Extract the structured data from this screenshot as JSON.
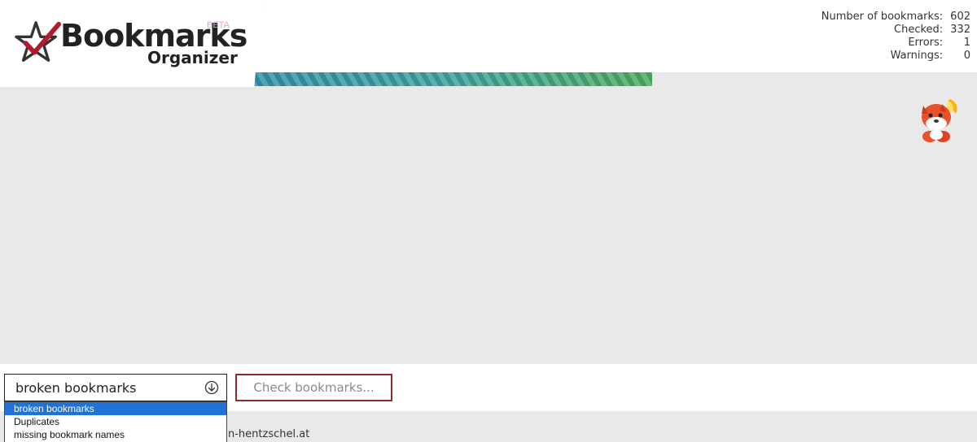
{
  "logo": {
    "title": "Bookmarks",
    "beta": "BETA",
    "subtitle": "Organizer"
  },
  "progress": {
    "fraction": 0.552
  },
  "stats": [
    {
      "label": "Number of bookmarks:",
      "value": "602"
    },
    {
      "label": "Checked:",
      "value": "332"
    },
    {
      "label": "Errors:",
      "value": "1"
    },
    {
      "label": "Warnings:",
      "value": "0"
    }
  ],
  "filter": {
    "selected": "broken bookmarks",
    "options": [
      "broken bookmarks",
      "Duplicates",
      "missing bookmark names"
    ]
  },
  "check_button": {
    "label": "Check bookmarks..."
  },
  "footer": {
    "text": "n-hentzschel.at"
  },
  "colors": {
    "accent": "#1e72d8",
    "button_border": "#8e2a2a",
    "progress_start": "#2f8ea6",
    "progress_end": "#4aa85b"
  },
  "icons": {
    "logo": "star-check-icon",
    "chevron": "circle-arrow-down-icon",
    "mascot": "fox-mascot-icon"
  }
}
